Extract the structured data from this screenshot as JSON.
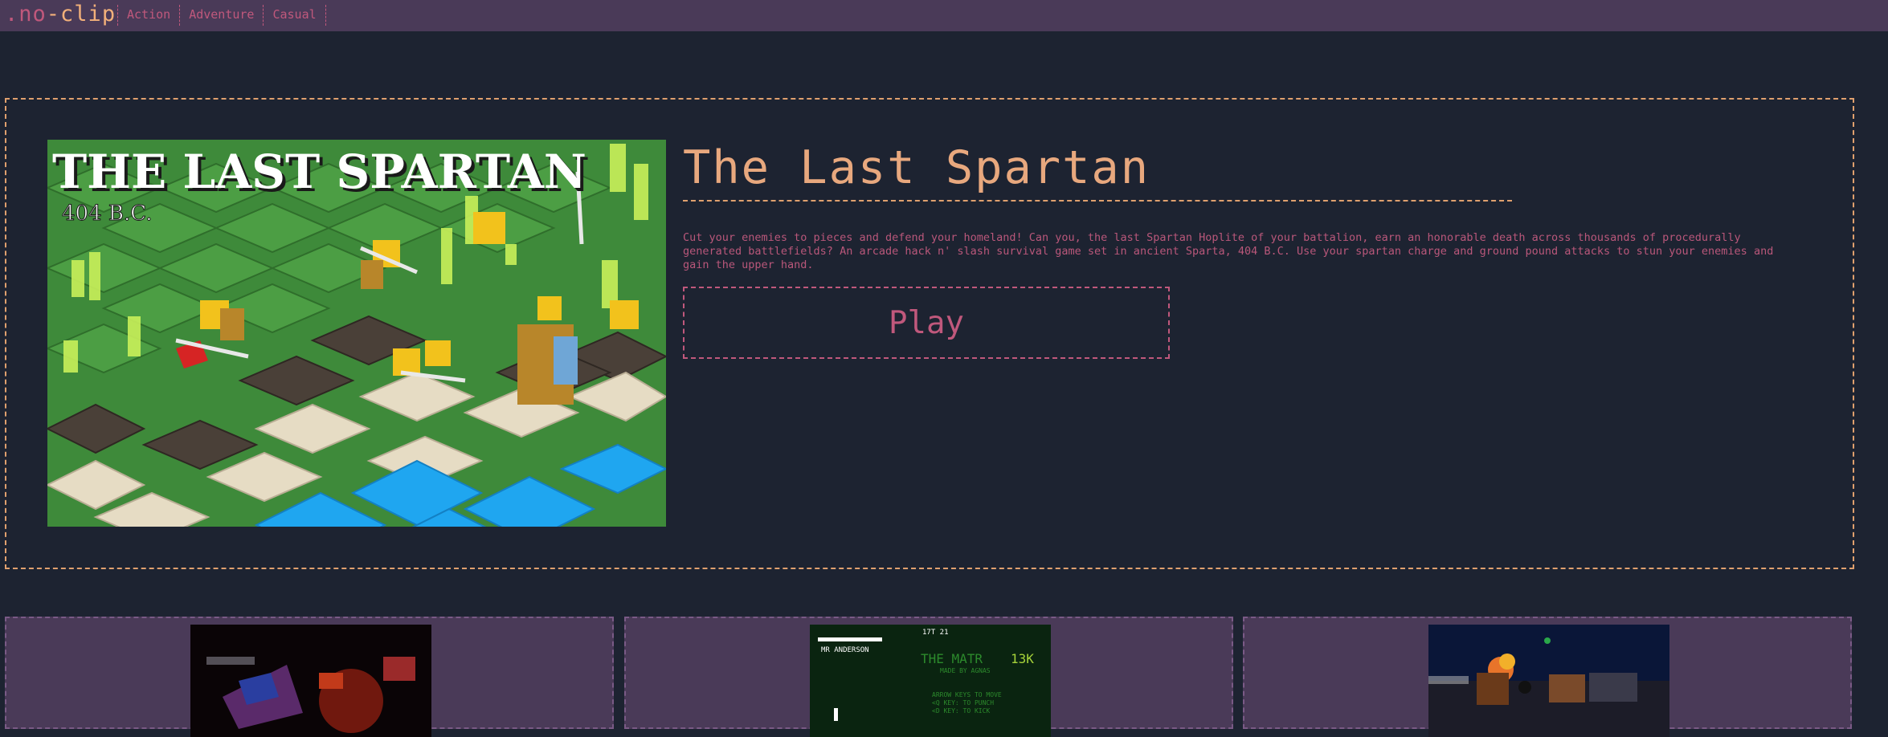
{
  "site": {
    "logo": {
      "dot": ".",
      "no": "no",
      "dash": "-",
      "clip": "clip"
    },
    "nav": [
      {
        "label": "Action"
      },
      {
        "label": "Adventure"
      },
      {
        "label": "Casual"
      }
    ]
  },
  "featured": {
    "title": "The Last Spartan",
    "image_caption": {
      "title": "THE LAST SPARTAN",
      "subtitle": "404 B.C."
    },
    "description": "Cut your enemies to pieces and defend your homeland! Can you, the last Spartan Hoplite of your battalion, earn an honorable death across thousands of procedurally generated battlefields? An arcade hack n' slash survival game set in ancient Sparta, 404 B.C. Use your spartan charge and ground pound attacks to stun your enemies and gain the upper hand.",
    "play_label": "Play"
  },
  "cards": [
    {
      "thumb_text": []
    },
    {
      "thumb_text": [
        "THE MATR",
        "13K",
        "MADE BY AGNAS",
        "ARROW KEYS TO MOVE",
        "<Q KEY: TO PUNCH",
        "<D KEY: TO KICK",
        "MR ANDERSON",
        "17T 21"
      ]
    },
    {
      "thumb_text": []
    }
  ],
  "colors": {
    "background": "#1d2331",
    "nav_bar": "#4a3a58",
    "accent_pink": "#c0587c",
    "accent_orange": "#e8a87e"
  }
}
